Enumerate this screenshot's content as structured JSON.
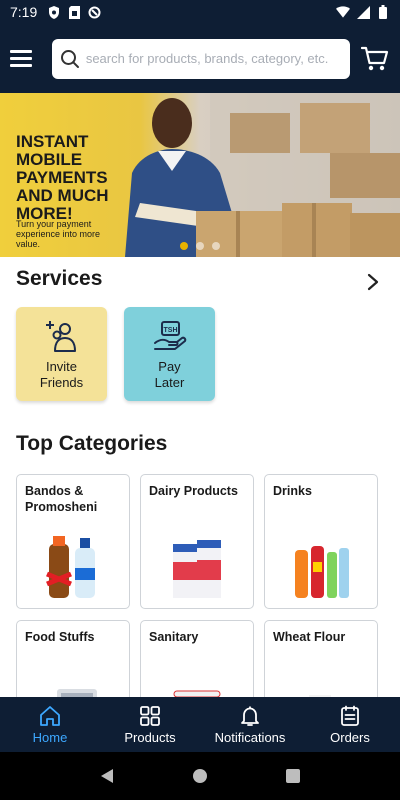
{
  "status_bar": {
    "time": "7:19"
  },
  "header": {
    "search_placeholder": "search for products, brands, category, etc."
  },
  "banner": {
    "headline": "INSTANT\nMOBILE\nPAYMENTS\nAND MUCH\nMORE!",
    "subtext": "Turn your payment experience into more value.",
    "slide_count": 3,
    "active_slide": 1
  },
  "services": {
    "title": "Services",
    "items": [
      {
        "label": "Invite\nFriends",
        "icon": "invite-friends-icon",
        "color": "#f4e298"
      },
      {
        "label": "Pay\nLater",
        "icon": "pay-later-icon",
        "color": "#7fd0db",
        "badge": "TSH"
      }
    ]
  },
  "categories": {
    "title": "Top Categories",
    "items": [
      {
        "name": "Bandos & Promosheni"
      },
      {
        "name": "Dairy Products"
      },
      {
        "name": "Drinks"
      },
      {
        "name": "Food Stuffs"
      },
      {
        "name": "Sanitary"
      },
      {
        "name": "Wheat Flour"
      }
    ]
  },
  "bottom_nav": {
    "items": [
      {
        "label": "Home",
        "icon": "home-icon",
        "active": true
      },
      {
        "label": "Products",
        "icon": "grid-icon",
        "active": false
      },
      {
        "label": "Notifications",
        "icon": "bell-icon",
        "active": false
      },
      {
        "label": "Orders",
        "icon": "orders-icon",
        "active": false
      }
    ]
  },
  "colors": {
    "header_bg": "#0e1e34",
    "active_nav": "#3da8ff",
    "banner_yellow": "#e6c23a",
    "invite_card": "#f4e298",
    "pay_later_card": "#7fd0db"
  }
}
